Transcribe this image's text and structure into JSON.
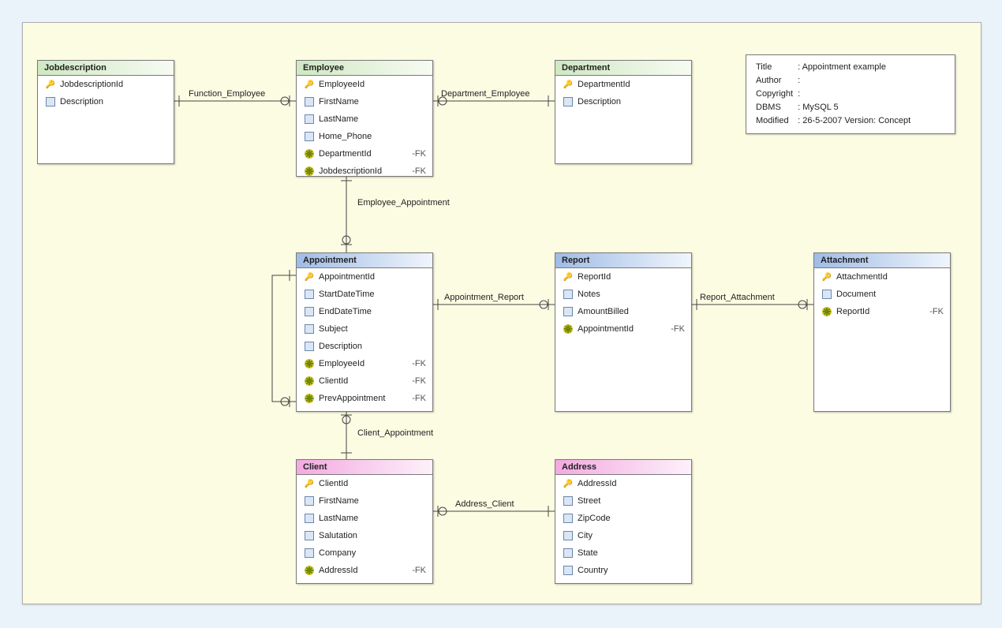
{
  "info": {
    "title": "Appointment example",
    "author": "",
    "copyright": "",
    "dbms": "MySQL 5",
    "modified": "26-5-2007 Version: Concept",
    "labels": {
      "Title": "Title",
      "Author": "Author",
      "Copyright": "Copyright",
      "DBMS": "DBMS",
      "Modified": "Modified"
    }
  },
  "relationships": {
    "Function_Employee": "Function_Employee",
    "Department_Employee": "Department_Employee",
    "Employee_Appointment": "Employee_Appointment",
    "Appointment_Report": "Appointment_Report",
    "Report_Attachment": "Report_Attachment",
    "Client_Appointment": "Client_Appointment",
    "Address_Client": "Address_Client"
  },
  "entities": {
    "Jobdescription": {
      "title": "Jobdescription",
      "fields": [
        {
          "name": "JobdescriptionId",
          "kind": "pk"
        },
        {
          "name": "Description",
          "kind": "col"
        }
      ]
    },
    "Employee": {
      "title": "Employee",
      "fields": [
        {
          "name": "EmployeeId",
          "kind": "pk"
        },
        {
          "name": "FirstName",
          "kind": "col"
        },
        {
          "name": "LastName",
          "kind": "col"
        },
        {
          "name": "Home_Phone",
          "kind": "col"
        },
        {
          "name": "DepartmentId",
          "kind": "fk",
          "suffix": "-FK"
        },
        {
          "name": "JobdescriptionId",
          "kind": "fk",
          "suffix": "-FK"
        }
      ]
    },
    "Department": {
      "title": "Department",
      "fields": [
        {
          "name": "DepartmentId",
          "kind": "pk"
        },
        {
          "name": "Description",
          "kind": "col"
        }
      ]
    },
    "Appointment": {
      "title": "Appointment",
      "fields": [
        {
          "name": "AppointmentId",
          "kind": "pk"
        },
        {
          "name": "StartDateTime",
          "kind": "col"
        },
        {
          "name": "EndDateTime",
          "kind": "col"
        },
        {
          "name": "Subject",
          "kind": "col"
        },
        {
          "name": "Description",
          "kind": "col"
        },
        {
          "name": "EmployeeId",
          "kind": "fk",
          "suffix": "-FK"
        },
        {
          "name": "ClientId",
          "kind": "fk",
          "suffix": "-FK"
        },
        {
          "name": "PrevAppointment",
          "kind": "fk",
          "suffix": "-FK"
        }
      ]
    },
    "Report": {
      "title": "Report",
      "fields": [
        {
          "name": "ReportId",
          "kind": "pk"
        },
        {
          "name": "Notes",
          "kind": "col"
        },
        {
          "name": "AmountBilled",
          "kind": "col"
        },
        {
          "name": "AppointmentId",
          "kind": "fk",
          "suffix": "-FK"
        }
      ]
    },
    "Attachment": {
      "title": "Attachment",
      "fields": [
        {
          "name": "AttachmentId",
          "kind": "pk"
        },
        {
          "name": "Document",
          "kind": "col"
        },
        {
          "name": "ReportId",
          "kind": "fk",
          "suffix": "-FK"
        }
      ]
    },
    "Client": {
      "title": "Client",
      "fields": [
        {
          "name": "ClientId",
          "kind": "pk"
        },
        {
          "name": "FirstName",
          "kind": "col"
        },
        {
          "name": "LastName",
          "kind": "col"
        },
        {
          "name": "Salutation",
          "kind": "col"
        },
        {
          "name": "Company",
          "kind": "col"
        },
        {
          "name": "AddressId",
          "kind": "fk",
          "suffix": "-FK"
        }
      ]
    },
    "Address": {
      "title": "Address",
      "fields": [
        {
          "name": "AddressId",
          "kind": "pk"
        },
        {
          "name": "Street",
          "kind": "col"
        },
        {
          "name": "ZipCode",
          "kind": "col"
        },
        {
          "name": "City",
          "kind": "col"
        },
        {
          "name": "State",
          "kind": "col"
        },
        {
          "name": "Country",
          "kind": "col"
        }
      ]
    }
  }
}
